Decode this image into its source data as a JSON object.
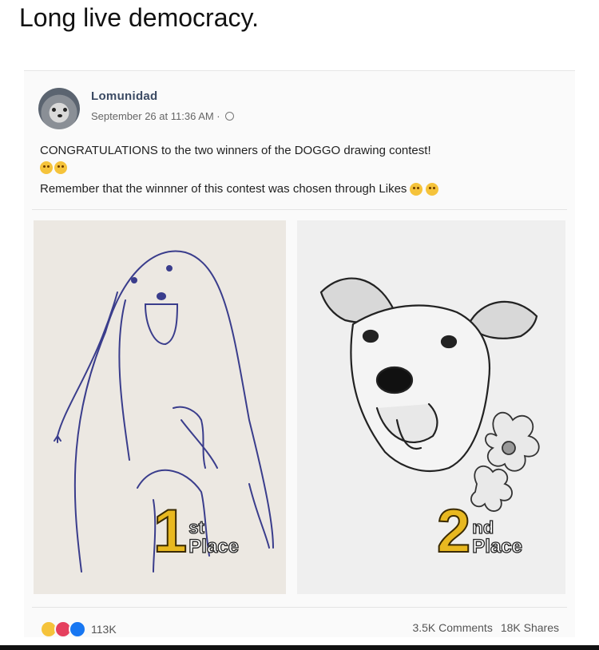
{
  "caption": "Long live democracy.",
  "post": {
    "author": "Lomunidad",
    "timestamp": "September 26 at 11:36 AM ·",
    "audience_icon": "globe-icon",
    "text_line1": "CONGRATULATIONS to the two winners of the DOGGO drawing contest!",
    "text_line2": "Remember that the winnner of this contest was chosen through Likes",
    "images": [
      {
        "place_number": "1",
        "suffix": "st",
        "label": "Place"
      },
      {
        "place_number": "2",
        "suffix": "nd",
        "label": "Place"
      }
    ],
    "reactions": {
      "icons": [
        "haha-icon",
        "love-icon",
        "like-icon"
      ],
      "count": "113K"
    },
    "comments": "3.5K Comments",
    "shares": "18K Shares"
  },
  "colors": {
    "badge_gold": "#e8b820",
    "author_blue": "#3b4a63"
  }
}
